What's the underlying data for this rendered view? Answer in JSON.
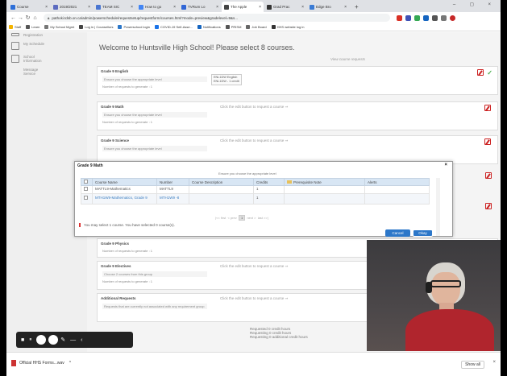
{
  "browser": {
    "tabs": [
      {
        "label": "Course",
        "color": "#2e6fd8",
        "active": false
      },
      {
        "label": "2019/2021",
        "color": "#5c6bc0",
        "active": false
      },
      {
        "label": "TEAM SIC",
        "color": "#4a76d1",
        "active": false
      },
      {
        "label": "How to go",
        "color": "#4285f4",
        "active": false
      },
      {
        "label": "TVRum Lo",
        "color": "#3166d6",
        "active": false
      },
      {
        "label": "The Apple",
        "color": "#444",
        "active": true
      },
      {
        "label": "Grad Prac",
        "color": "#333",
        "active": false
      },
      {
        "label": "Edge Bro",
        "color": "#3a7bd5",
        "active": false
      }
    ],
    "new_tab": "+",
    "window_controls": "–  ◻  ×",
    "url": "pathoki.tdsb.on.ca/admin/powerschedule/requestsetup/requestform/courses.html?mode=preview&gradelevel=9&s...",
    "extension_colors": [
      "#d93025",
      "#3f51b5",
      "#34a853",
      "#1565c0",
      "#555",
      "#777",
      "#c62828"
    ],
    "bookmarks": [
      {
        "label": "Staff",
        "color": "#f4b400"
      },
      {
        "label": "Learn",
        "color": "#555"
      },
      {
        "label": "My School Mgmt",
        "color": "#777"
      },
      {
        "label": "Log in | Counsellors",
        "color": "#444"
      },
      {
        "label": "Powerschool login",
        "color": "#2c77c9"
      },
      {
        "label": "COVID-19 Self-Asse...",
        "color": "#1a73e8"
      },
      {
        "label": "Notifications",
        "color": "#1565c0"
      },
      {
        "label": "PRISM",
        "color": "#555"
      },
      {
        "label": "Job Board",
        "color": "#666"
      },
      {
        "label": "HHS website log in",
        "color": "#333"
      }
    ]
  },
  "sidenav": {
    "items": [
      {
        "label": "Registration"
      },
      {
        "label": "My Schedule"
      },
      {
        "label": "School Information"
      },
      {
        "label": "Message Service"
      }
    ]
  },
  "main": {
    "welcome": "Welcome to Huntsville High School! Please select 8 courses.",
    "view_requests": "View course requests",
    "click_text": "Click the edit button to request a course ⇒",
    "hint_appropriate": "Ensure you choose the appropriate level",
    "hint_requests": "Number of requests to generate : 1",
    "grade9_english": "Grade 9 English",
    "grade9_math": "Grade 9 Math",
    "grade9_science": "Grade 9 Science",
    "grade9_physics": "Grade 9 Physics",
    "grade9_electives": "Grade 9 Electives",
    "electives_hint": "Choose 2 courses from this group",
    "additional": "Additional Requests",
    "additional_hint": "Requests that are currently not associated with any requirement group.",
    "english_selected_line1": "ENL1DW English",
    "english_selected_line2": "ENL1DW - 1 credit",
    "info_line1": "Requested 0 credit hours",
    "info_line2": "Requesting 0 credit hours",
    "info_line3": "Requesting 0 additional credit hours"
  },
  "modal": {
    "title": "Grade 9 Math",
    "close": "×",
    "instruction": "Ensure you choose the appropriate level",
    "headers": [
      "Course Name",
      "Number",
      "Course Description",
      "Credits",
      "Prerequisite Note",
      "Alerts"
    ],
    "rows": [
      {
        "name": "MATTL9-Mathematics",
        "number": "MATTL9",
        "description": "",
        "credits": "1",
        "note": "",
        "alerts": ""
      },
      {
        "name": "MTH1W9-Mathematics, Grade 9",
        "number": "MTH1W9 -8",
        "description": "",
        "credits": "1",
        "note": "",
        "alerts": ""
      }
    ],
    "pager": {
      "first": "|<< first",
      "prev": "< prev",
      "page": "1",
      "next": "next >",
      "last": "last >>|"
    },
    "message": "You may select 1 course.  You have selected 0 course(s).",
    "cancel": "Cancel",
    "okay": "Okay"
  },
  "downloads": {
    "file": "Official HHS Forms...wav",
    "chevron": "^",
    "show_all": "Show all",
    "close": "×"
  },
  "recorder": {
    "stop": "■",
    "pause": "⏸",
    "pen": "✎",
    "minus": "—",
    "back": "‹"
  }
}
